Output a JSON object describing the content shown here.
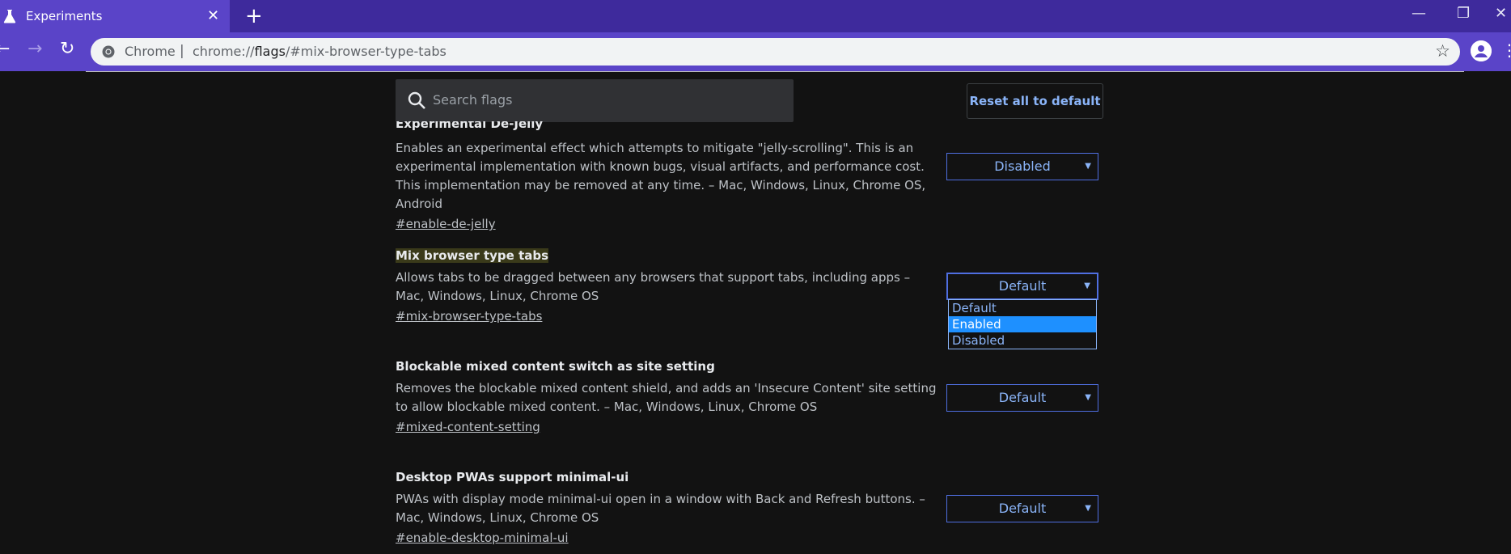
{
  "tab": {
    "title": "Experiments",
    "close_icon": "close-icon"
  },
  "toolbar": {
    "scheme_label": "Chrome",
    "url_prefix": "chrome://",
    "url_host": "flags",
    "url_path": "/#mix-browser-type-tabs"
  },
  "search": {
    "placeholder": "Search flags"
  },
  "reset_label": "Reset all to default",
  "flags": [
    {
      "description": "Enables an experimental effect which attempts to mitigate \"jelly-scrolling\". This is an experimental implementation with known bugs, visual artifacts, and performance cost. This implementation may be removed at any time. – Mac, Windows, Linux, Chrome OS, Android",
      "permalink": "#enable-de-jelly",
      "value": "Disabled"
    },
    {
      "name": "Mix browser type tabs",
      "description": "Allows tabs to be dragged between any browsers that support tabs, including apps – Mac, Windows, Linux, Chrome OS",
      "permalink": "#mix-browser-type-tabs",
      "value": "Default",
      "options": [
        "Default",
        "Enabled",
        "Disabled"
      ],
      "highlighted_option": "Enabled"
    },
    {
      "name": "Blockable mixed content switch as site setting",
      "description": "Removes the blockable mixed content shield, and adds an 'Insecure Content' site setting to allow blockable mixed content. – Mac, Windows, Linux, Chrome OS",
      "permalink": "#mixed-content-setting",
      "value": "Default"
    },
    {
      "name": "Desktop PWAs support minimal-ui",
      "description": "PWAs with display mode minimal-ui open in a window with Back and Refresh buttons. – Mac, Windows, Linux, Chrome OS",
      "permalink": "#enable-desktop-minimal-ui",
      "value": "Default"
    }
  ],
  "colors": {
    "accent": "#8ab4f8",
    "tab_strip": "#3e2a9c",
    "toolbar": "#5a44c8",
    "background": "#121212",
    "selected_option": "#1e90ff"
  }
}
